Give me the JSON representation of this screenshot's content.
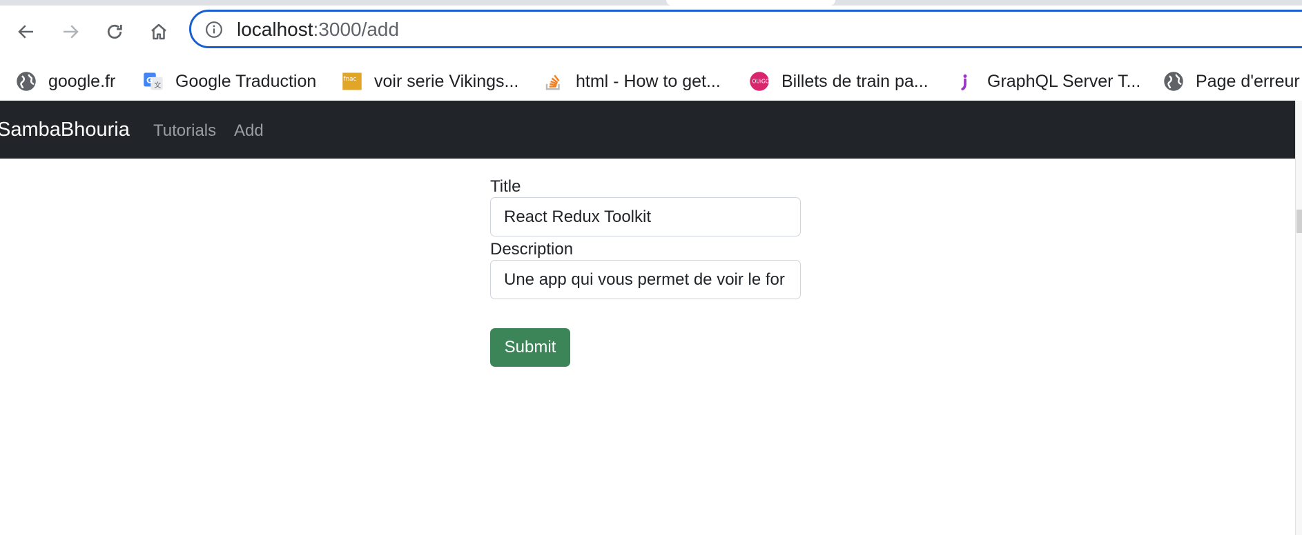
{
  "browser": {
    "address_bar": {
      "host": "localhost",
      "path": ":3000/add"
    },
    "nav_buttons": {
      "back_icon": "arrow-left-icon",
      "forward_icon": "arrow-right-icon",
      "reload_icon": "reload-icon",
      "home_icon": "home-icon"
    },
    "bookmarks": [
      {
        "label": "google.fr",
        "icon": "globe-icon"
      },
      {
        "label": "Google Traduction",
        "icon": "google-translate-icon"
      },
      {
        "label": "voir serie Vikings...",
        "icon": "fnac-icon"
      },
      {
        "label": "html - How to get...",
        "icon": "stackoverflow-icon"
      },
      {
        "label": "Billets de train pa...",
        "icon": "ouigo-icon"
      },
      {
        "label": "GraphQL Server T...",
        "icon": "graphql-icon"
      },
      {
        "label": "Page d'erreur",
        "icon": "globe-icon"
      }
    ]
  },
  "navbar": {
    "brand": "SambaBhouria",
    "links": [
      "Tutorials",
      "Add"
    ],
    "background_color": "#212529"
  },
  "form": {
    "title_label": "Title",
    "title_value": "React Redux Toolkit",
    "description_label": "Description",
    "description_value": "Une app qui vous permet de voir le for",
    "submit_label": "Submit",
    "submit_color": "#3b8559"
  },
  "colors": {
    "omnibox_focus": "#1a5fd0"
  }
}
